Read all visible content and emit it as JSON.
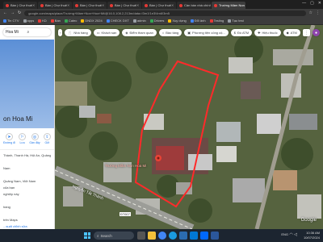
{
  "browser": {
    "tabs": [
      {
        "label": "Bán | Chợ thuê",
        "active": false
      },
      {
        "label": "Bán | Chợ thuê",
        "active": false
      },
      {
        "label": "Bán | Chợ thuê",
        "active": false
      },
      {
        "label": "Bán | Chợ thuê",
        "active": false
      },
      {
        "label": "Bán | Chợ thuê",
        "active": false
      },
      {
        "label": "Cần bán nhà chính chủ...",
        "active": false
      },
      {
        "label": "Trường Mầm Non Hoa Mi",
        "active": true
      }
    ],
    "url": "google.com/maps/place/Trường+Mầm+Non+Hoa+Mi/@16.0,108.2,213m/data=!3m1!1e3!4m6!3m5",
    "bookmarks": [
      {
        "label": "Tin CTV",
        "color": "#4285f4"
      },
      {
        "label": "apps",
        "color": "#9aa0a6"
      },
      {
        "label": "KD",
        "color": "#e53935"
      },
      {
        "label": "Bán",
        "color": "#e53935"
      },
      {
        "label": "Catec",
        "color": "#34a853"
      },
      {
        "label": "DNDX 2024",
        "color": "#fbbc04"
      },
      {
        "label": "CHECK DXT",
        "color": "#4285f4"
      },
      {
        "label": "admin",
        "color": "#9aa0a6"
      },
      {
        "label": "Drivers",
        "color": "#34a853"
      },
      {
        "label": "Xuy dựng",
        "color": "#fbbc04"
      },
      {
        "label": "Đổi ảnh",
        "color": "#4285f4"
      },
      {
        "label": "Testing",
        "color": "#e53935"
      },
      {
        "label": "Tạo test",
        "color": "#9aa0a6"
      }
    ]
  },
  "sidebar": {
    "search_value": "Hoa Mi",
    "place_title": "on Hoa Mi",
    "actions": [
      {
        "label": "Đường đi",
        "icon": "directions-icon",
        "glyph": "➤"
      },
      {
        "label": "Lưu",
        "icon": "bookmark-icon",
        "glyph": "⚐"
      },
      {
        "label": "Gần đây",
        "icon": "nearby-icon",
        "glyph": "◎"
      },
      {
        "label": "Gửi",
        "icon": "send-icon",
        "glyph": "⇪"
      }
    ],
    "info": [
      "Thành, Thanh Hà, Hội An, Quảng",
      "",
      "Nam",
      "",
      "Quảng Nam, Việt Nam",
      "của bạn",
      "nghiệp này",
      "",
      "hàng",
      "",
      "trên Maps"
    ],
    "footer_link": "...suất chỉnh sửa"
  },
  "map": {
    "chips": [
      {
        "label": "Nhà hàng",
        "icon": "restaurant-icon",
        "glyph": "🍴"
      },
      {
        "label": "Khách sạn",
        "icon": "hotel-icon",
        "glyph": "▭"
      },
      {
        "label": "Điểm tham quan",
        "icon": "attraction-icon",
        "glyph": "◈"
      },
      {
        "label": "Bảo tàng",
        "icon": "museum-icon",
        "glyph": "⌂"
      },
      {
        "label": "Phương tiện công cộ...",
        "icon": "transit-icon",
        "glyph": "▣"
      },
      {
        "label": "Đồ ATM",
        "icon": "atm-icon",
        "glyph": "$"
      },
      {
        "label": "Hiệu thuốc",
        "icon": "pharmacy-icon",
        "glyph": "✚"
      },
      {
        "label": "ATM",
        "icon": "atm-icon",
        "glyph": "◆"
      }
    ],
    "street_label": "Nguyễn Tất Thành",
    "road_badge": "ĐT607",
    "place_label": "Trường Mầm Non Hoa Mi",
    "google_label": "Google"
  },
  "taskbar": {
    "search_label": "Search",
    "time": "10:36 AM",
    "date": "10/07/2024",
    "tray": "ENG"
  }
}
